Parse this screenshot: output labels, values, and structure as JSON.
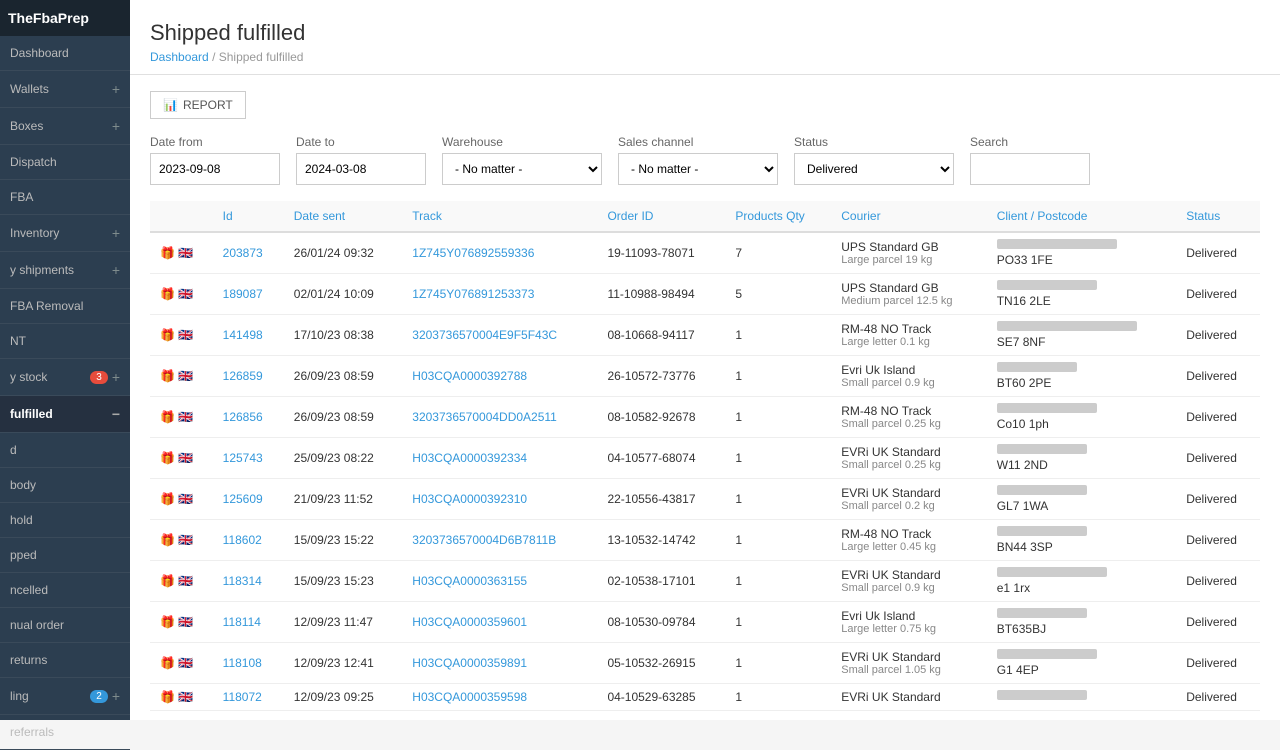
{
  "app": {
    "logo": "TheFbaPrep"
  },
  "sidebar": {
    "items": [
      {
        "id": "dashboard",
        "label": "Dashboard",
        "badge": null,
        "active": false
      },
      {
        "id": "wallets",
        "label": "Wallets",
        "badge": null,
        "plus": true
      },
      {
        "id": "boxes",
        "label": "Boxes",
        "badge": null,
        "plus": true
      },
      {
        "id": "dispatch",
        "label": "Dispatch",
        "badge": null,
        "plus": false
      },
      {
        "id": "fba",
        "label": "FBA",
        "badge": null,
        "plus": false
      },
      {
        "id": "inventory",
        "label": "Inventory",
        "badge": null,
        "plus": true
      },
      {
        "id": "y-shipments",
        "label": "y shipments",
        "badge": null,
        "plus": true
      },
      {
        "id": "fba-removal",
        "label": "FBA Removal",
        "badge": null,
        "plus": false
      },
      {
        "id": "nt",
        "label": "NT",
        "badge": null,
        "plus": false
      },
      {
        "id": "y-stock",
        "label": "y stock",
        "badge": "3",
        "badgeType": "red",
        "plus": true
      },
      {
        "id": "fulfilled",
        "label": "fulfilled",
        "badge": null,
        "active": true,
        "plus": false
      },
      {
        "id": "d",
        "label": "d",
        "badge": null,
        "plus": false
      },
      {
        "id": "body",
        "label": "body",
        "badge": null,
        "plus": false
      },
      {
        "id": "hold",
        "label": "hold",
        "badge": null,
        "plus": false
      },
      {
        "id": "pped",
        "label": "pped",
        "badge": null,
        "plus": false
      },
      {
        "id": "ncelled",
        "label": "ncelled",
        "badge": null,
        "plus": false
      },
      {
        "id": "nual-order",
        "label": "nual order",
        "badge": null,
        "plus": false
      },
      {
        "id": "returns",
        "label": "returns",
        "badge": null,
        "plus": false
      },
      {
        "id": "ling",
        "label": "ling",
        "badge": "2",
        "badgeType": "blue",
        "plus": true
      },
      {
        "id": "referrals",
        "label": "referrals",
        "badge": null,
        "plus": false
      }
    ]
  },
  "page": {
    "title": "Shipped fulfilled",
    "breadcrumb_home": "Dashboard",
    "breadcrumb_current": "Shipped fulfilled"
  },
  "toolbar": {
    "report_label": "REPORT"
  },
  "filters": {
    "date_from_label": "Date from",
    "date_from_value": "2023-09-08",
    "date_to_label": "Date to",
    "date_to_value": "2024-03-08",
    "warehouse_label": "Warehouse",
    "warehouse_value": "- No matter -",
    "sales_channel_label": "Sales channel",
    "sales_channel_value": "- No matter -",
    "status_label": "Status",
    "status_value": "Delivered",
    "search_label": "Search",
    "search_placeholder": ""
  },
  "table": {
    "columns": [
      "Id",
      "Date sent",
      "Track",
      "Order ID",
      "Products Qty",
      "Courier",
      "Client / Postcode",
      "Status"
    ],
    "rows": [
      {
        "id": "203873",
        "date_sent": "26/01/24 09:32",
        "track": "1Z745Y076892559336",
        "order_id": "19-11093-78071",
        "qty": "7",
        "courier": "UPS Standard GB",
        "courier_size": "Large parcel 19 kg",
        "client_blur": "120px",
        "postcode": "PO33 1FE",
        "status": "Delivered"
      },
      {
        "id": "189087",
        "date_sent": "02/01/24 10:09",
        "track": "1Z745Y076891253373",
        "order_id": "11-10988-98494",
        "qty": "5",
        "courier": "UPS Standard GB",
        "courier_size": "Medium parcel 12.5 kg",
        "client_blur": "100px",
        "postcode": "TN16 2LE",
        "status": "Delivered"
      },
      {
        "id": "141498",
        "date_sent": "17/10/23 08:38",
        "track": "3203736570004E9F5F43C",
        "order_id": "08-10668-94117",
        "qty": "1",
        "courier": "RM-48 NO Track",
        "courier_size": "Large letter 0.1 kg",
        "client_blur": "140px",
        "postcode": "SE7 8NF",
        "status": "Delivered"
      },
      {
        "id": "126859",
        "date_sent": "26/09/23 08:59",
        "track": "H03CQA0000392788",
        "order_id": "26-10572-73776",
        "qty": "1",
        "courier": "Evri Uk Island",
        "courier_size": "Small parcel 0.9 kg",
        "client_blur": "80px",
        "postcode": "BT60 2PE",
        "status": "Delivered"
      },
      {
        "id": "126856",
        "date_sent": "26/09/23 08:59",
        "track": "3203736570004DD0A2511",
        "order_id": "08-10582-92678",
        "qty": "1",
        "courier": "RM-48 NO Track",
        "courier_size": "Small parcel 0.25 kg",
        "client_blur": "100px",
        "postcode": "Co10 1ph",
        "status": "Delivered"
      },
      {
        "id": "125743",
        "date_sent": "25/09/23 08:22",
        "track": "H03CQA0000392334",
        "order_id": "04-10577-68074",
        "qty": "1",
        "courier": "EVRi UK Standard",
        "courier_size": "Small parcel 0.25 kg",
        "client_blur": "90px",
        "postcode": "W11 2ND",
        "status": "Delivered"
      },
      {
        "id": "125609",
        "date_sent": "21/09/23 11:52",
        "track": "H03CQA0000392310",
        "order_id": "22-10556-43817",
        "qty": "1",
        "courier": "EVRi UK Standard",
        "courier_size": "Small parcel 0.2 kg",
        "client_blur": "90px",
        "postcode": "GL7 1WA",
        "status": "Delivered"
      },
      {
        "id": "118602",
        "date_sent": "15/09/23 15:22",
        "track": "3203736570004D6B7811B",
        "order_id": "13-10532-14742",
        "qty": "1",
        "courier": "RM-48 NO Track",
        "courier_size": "Large letter 0.45 kg",
        "client_blur": "90px",
        "postcode": "BN44 3SP",
        "status": "Delivered"
      },
      {
        "id": "118314",
        "date_sent": "15/09/23 15:23",
        "track": "H03CQA0000363155",
        "order_id": "02-10538-17101",
        "qty": "1",
        "courier": "EVRi UK Standard",
        "courier_size": "Small parcel 0.9 kg",
        "client_blur": "110px",
        "postcode": "e1 1rx",
        "status": "Delivered"
      },
      {
        "id": "118114",
        "date_sent": "12/09/23 11:47",
        "track": "H03CQA0000359601",
        "order_id": "08-10530-09784",
        "qty": "1",
        "courier": "Evri Uk Island",
        "courier_size": "Large letter 0.75 kg",
        "client_blur": "90px",
        "postcode": "BT635BJ",
        "status": "Delivered"
      },
      {
        "id": "118108",
        "date_sent": "12/09/23 12:41",
        "track": "H03CQA0000359891",
        "order_id": "05-10532-26915",
        "qty": "1",
        "courier": "EVRi UK Standard",
        "courier_size": "Small parcel 1.05 kg",
        "client_blur": "100px",
        "postcode": "G1 4EP",
        "status": "Delivered"
      },
      {
        "id": "118072",
        "date_sent": "12/09/23 09:25",
        "track": "H03CQA0000359598",
        "order_id": "04-10529-63285",
        "qty": "1",
        "courier": "EVRi UK Standard",
        "courier_size": "",
        "client_blur": "90px",
        "postcode": "",
        "status": "Delivered"
      }
    ]
  }
}
